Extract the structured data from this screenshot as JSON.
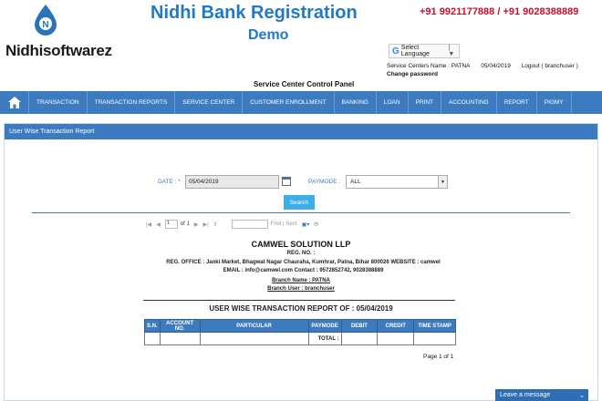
{
  "header": {
    "logo_text": "Nidhisoftwarez",
    "logo_letter": "N",
    "banner_title": "Nidhi Bank Registration",
    "banner_subtitle": "Demo",
    "phones": "+91 9921177888 / +91 9028388889",
    "language_label": "Select Language",
    "service_center": "Service Centers Name : PATNA",
    "date": "05/04/2019",
    "logout": "Logout ( branchuser )",
    "change_password": "Change password",
    "panel_title": "Service Center Control Panel"
  },
  "nav": {
    "items": [
      "TRANSACTION",
      "TRANSACTION REPORTS",
      "SERVICE CENTER",
      "CUSTOMER ENROLLMENT",
      "BANKING",
      "LOAN",
      "PRINT",
      "ACCOUNTING",
      "REPORT",
      "PIGMY"
    ]
  },
  "panel": {
    "title": "User Wise Transaction Report",
    "date_label": "DATE : *",
    "date_value": "05/04/2019",
    "paymode_label": "PAYMODE :",
    "paymode_value": "ALL",
    "search_label": "Search"
  },
  "toolbar": {
    "page_value": "1",
    "of_text": "of 1",
    "find_text": "Find | Next"
  },
  "report": {
    "company": "CAMWEL SOLUTION LLP",
    "reg_no": "REG. NO. :",
    "office": "REG. OFFICE : Janki Market, Bhagwat Nagar Chauraha, Kumhrar, Patna, Bihar 800026 WEBSITE : camwel     EMAIL : info@camwel.com     Contact : 9572852742, 9028388889",
    "branch_name": "Branch Name : PATNA",
    "branch_user": "Branch User : branchuser",
    "title": "USER WISE TRANSACTION REPORT OF : 05/04/2019",
    "columns": [
      "S.N.",
      "ACCOUNT NO.",
      "PARTICULAR",
      "PAYMODE",
      "DEBIT",
      "CREDIT",
      "TIME STAMP"
    ],
    "total_label": "TOTAL :",
    "page_text": "Page 1 of 1"
  },
  "chat": {
    "label": "Leave a message"
  },
  "colors": {
    "nav_blue": "#3d7bc0",
    "banner_blue": "#1f78c8",
    "phone_red": "#c8102e",
    "search_blue": "#3daee9"
  }
}
